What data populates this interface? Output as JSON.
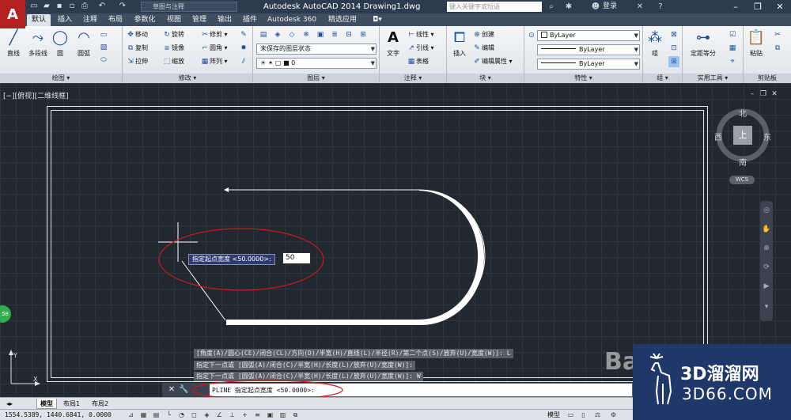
{
  "app": {
    "logo": "A",
    "title": "Autodesk AutoCAD 2014    Drawing1.dwg",
    "workspace": "草图与注释",
    "search_placeholder": "键入关键字或短语",
    "login": "登录"
  },
  "tabs": [
    "默认",
    "插入",
    "注释",
    "布局",
    "参数化",
    "视图",
    "管理",
    "输出",
    "插件",
    "Autodesk 360",
    "精选应用"
  ],
  "ribbon": {
    "draw": {
      "title": "绘图",
      "line": "直线",
      "polyline": "多段线",
      "circle": "圆",
      "arc": "圆弧"
    },
    "modify": {
      "title": "修改",
      "move": "移动",
      "rotate": "旋转",
      "trim": "修剪",
      "copy": "复制",
      "mirror": "镜像",
      "fillet": "圆角",
      "stretch": "拉伸",
      "scale": "缩放",
      "array": "阵列"
    },
    "layers": {
      "title": "图层",
      "layer_state": "未保存的图层状态",
      "current_layer": "0"
    },
    "annotation": {
      "title": "注释",
      "text": "文字",
      "linear": "线性",
      "leader": "引线",
      "table": "表格"
    },
    "block": {
      "title": "块",
      "insert": "插入",
      "create": "创建",
      "edit": "编辑",
      "edit_attr": "编辑属性"
    },
    "properties": {
      "title": "特性",
      "color": "ByLayer",
      "linetype": "ByLayer",
      "lineweight": "ByLayer"
    },
    "groups": {
      "title": "组",
      "group": "组"
    },
    "utilities": {
      "title": "实用工具",
      "measure": "定距等分"
    },
    "clipboard": {
      "title": "剪贴板",
      "paste": "粘贴"
    }
  },
  "viewport": {
    "label": "[−][俯视][二维线框]",
    "viewcube": {
      "north": "北",
      "south": "南",
      "east": "东",
      "west": "西",
      "top": "上",
      "wcs": "WCS"
    },
    "badge": "58",
    "dynamic_prompt": "指定起点宽度 <50.0000>:",
    "dynamic_input": "50"
  },
  "history": [
    "[角度(A)/圆心(CE)/闭合(CL)/方向(D)/半宽(H)/直线(L)/半径(R)/第二个点(S)/放弃(U)/宽度(W)]: L",
    "指定下一点或 [圆弧(A)/闭合(C)/半宽(H)/长度(L)/放弃(U)/宽度(W)]:",
    "指定下一点或 [圆弧(A)/闭合(C)/半宽(H)/长度(L)/放弃(U)/宽度(W)]: W"
  ],
  "command_line": "PLINE 指定起点宽度 <50.0000>:",
  "layout_tabs": [
    "模型",
    "布局1",
    "布局2"
  ],
  "status": {
    "coords": "1554.5389, 1440.6841, 0.0000",
    "model": "模型"
  },
  "watermark": {
    "brand": "3D溜溜网",
    "url": "3D66.COM",
    "baidu": "Ba"
  },
  "colors": {
    "title_bar": "#2d3b4f",
    "ribbon": "#e6e9ed",
    "canvas": "#212830",
    "annotation_circle": "#d01818",
    "logo_red": "#b22020",
    "watermark_bg": "#1f3769"
  }
}
